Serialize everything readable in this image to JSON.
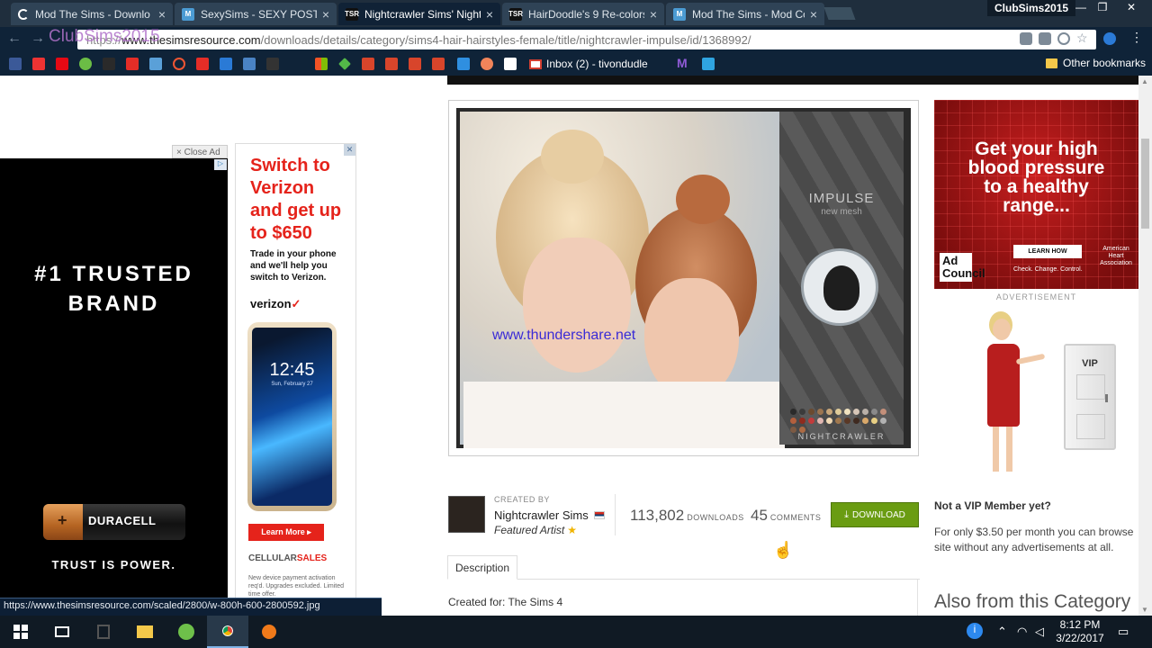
{
  "browser": {
    "tabs": [
      {
        "title": "Mod The Sims - Downlo",
        "icon": "loading-spinner-icon",
        "active": false
      },
      {
        "title": "SexySims - SEXY POSTER",
        "icon": "mts-favicon",
        "active": false
      },
      {
        "title": "Nightcrawler Sims' Night",
        "icon": "tsr-favicon",
        "active": true
      },
      {
        "title": "HairDoodle's 9 Re-colors",
        "icon": "tsr-favicon",
        "active": false
      },
      {
        "title": "Mod The Sims - Mod Co",
        "icon": "mts-favicon",
        "active": false
      }
    ],
    "profile_name": "ClubSims2015",
    "watermark": "ClubSims2015",
    "url_prefix": "https://",
    "url_host": "www.thesimsresource.com",
    "url_path": "/downloads/details/category/sims4-hair-hairstyles-female/title/nightcrawler-impulse/id/1368992/",
    "bookmark_inbox": "Inbox (2) - tivondudle",
    "bookmark_other": "Other bookmarks"
  },
  "ads": {
    "close_ad": "× Close Ad",
    "duracell": {
      "headline": "#1 TRUSTED\nBRAND",
      "brand": "DURACELL",
      "tagline": "TRUST IS POWER."
    },
    "verizon": {
      "headline": "Switch to Verizon and get up to $650",
      "subtext": "Trade in your phone and we'll help you switch to Verizon.",
      "logo": "verizon",
      "phone_time": "12:45",
      "phone_date": "Sun, February 27",
      "cta": "Learn More ▸",
      "retailer_a": "CELLULAR",
      "retailer_b": "SALES",
      "fineprint": "New device payment activation req'd. Upgrades excluded. Limited time offer."
    },
    "bp": {
      "headline": "Get your high blood pressure to a healthy range...",
      "cta": "LEARN HOW",
      "council": "Ad Council",
      "check": "Check. Change. Control.",
      "aha": "American Heart Association"
    },
    "advertisement_label": "ADVERTISEMENT"
  },
  "product": {
    "image_watermark": "www.thundershare.net",
    "image_title": "IMPULSE",
    "image_subtitle": "new mesh",
    "image_signature": "NIGHTCRAWLER",
    "swatch_colors": [
      "#2a2a2a",
      "#3b3b3b",
      "#6b4a2f",
      "#9c7550",
      "#c9a77a",
      "#e0cc9a",
      "#f0e2bf",
      "#d6c6b8",
      "#b9b0a8",
      "#8a8a8a",
      "#c38f7a",
      "#b35f3d",
      "#8f2b1e",
      "#c23b3b",
      "#e0b6b0",
      "#f1d9b4",
      "#a0784e",
      "#5a3826",
      "#3f2a20",
      "#d9a86a",
      "#e8cf84",
      "#b2b2b2",
      "#7d5a43",
      "#ad6b44"
    ],
    "created_by_label": "CREATED BY",
    "creator": "Nightcrawler Sims",
    "featured": "Featured Artist",
    "downloads": "113,802",
    "downloads_label": "DOWNLOADS",
    "comments": "45",
    "comments_label": "COMMENTS",
    "download_button": "DOWNLOAD",
    "tab_description": "Description",
    "created_for": "Created for: The Sims 4",
    "also_from": "Also from this Category"
  },
  "vip": {
    "door_label": "VIP",
    "title": "Not a VIP Member yet?",
    "text": "For only $3.50 per month you can browse site without any advertisements at all."
  },
  "status_url": "https://www.thesimsresource.com/scaled/2800/w-800h-600-2800592.jpg",
  "taskbar": {
    "time": "8:12 PM",
    "date": "3/22/2017"
  }
}
